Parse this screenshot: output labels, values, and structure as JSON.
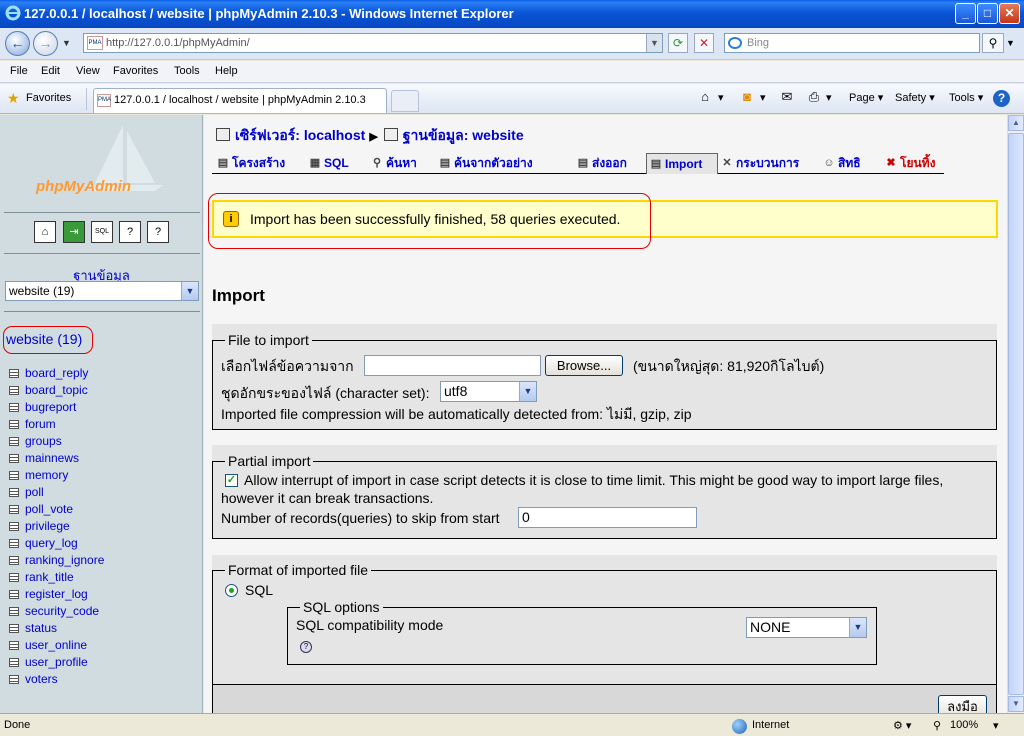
{
  "window": {
    "title": "127.0.0.1 / localhost / website | phpMyAdmin 2.10.3 - Windows Internet Explorer",
    "min": "_",
    "max": "□",
    "close": "✕"
  },
  "address": {
    "url": "http://127.0.0.1/phpMyAdmin/",
    "search_placeholder": "Bing"
  },
  "menu": [
    "File",
    "Edit",
    "View",
    "Favorites",
    "Tools",
    "Help"
  ],
  "favbar": {
    "favorites": "Favorites",
    "tab_title": "127.0.0.1 / localhost / website | phpMyAdmin 2.10.3",
    "commands": [
      "Page ▾",
      "Safety ▾",
      "Tools ▾"
    ]
  },
  "left": {
    "logo": "phpMyAdmin",
    "db_label": "ฐานข้อมูล",
    "db_select": "website (19)",
    "db_title": "website (19)",
    "tables": [
      "board_reply",
      "board_topic",
      "bugreport",
      "forum",
      "groups",
      "mainnews",
      "memory",
      "poll",
      "poll_vote",
      "privilege",
      "query_log",
      "ranking_ignore",
      "rank_title",
      "register_log",
      "security_code",
      "status",
      "user_online",
      "user_profile",
      "voters"
    ]
  },
  "main": {
    "crumb_server": "เซิร์ฟเวอร์: localhost",
    "crumb_db": "ฐานข้อมูล: website",
    "tabs": [
      "โครงสร้าง",
      "SQL",
      "ค้นหา",
      "ค้นจากตัวอย่าง",
      "ส่งออก",
      "Import",
      "กระบวนการ",
      "สิทธิ",
      "โยนทิ้ง"
    ],
    "notice": "Import has been successfully finished, 58 queries executed.",
    "heading": "Import",
    "file": {
      "legend": "File to import",
      "label": "เลือกไฟล์ข้อความจาก",
      "browse": "Browse...",
      "maxsize": "(ขนาดใหญ่สุด: 81,920กิโลไบต์)",
      "charset_label": "ชุดอักขระของไฟล์ (character set):",
      "charset": "utf8",
      "compression": "Imported file compression will be automatically detected from: ไม่มี, gzip, zip"
    },
    "partial": {
      "legend": "Partial import",
      "allow_line1": "Allow interrupt of import in case script detects it is close to time limit. This might be good way to import large files,",
      "allow_line2": "however it can break transactions.",
      "skip_label": "Number of records(queries) to skip from start",
      "skip_value": "0"
    },
    "format": {
      "legend": "Format of imported file",
      "sql": "SQL",
      "options_legend": "SQL options",
      "compat_label": "SQL compatibility mode",
      "compat_value": "NONE",
      "help": "?"
    },
    "go": "ลงมือ"
  },
  "status": {
    "done": "Done",
    "zone": "Internet",
    "zoom": "100%"
  }
}
